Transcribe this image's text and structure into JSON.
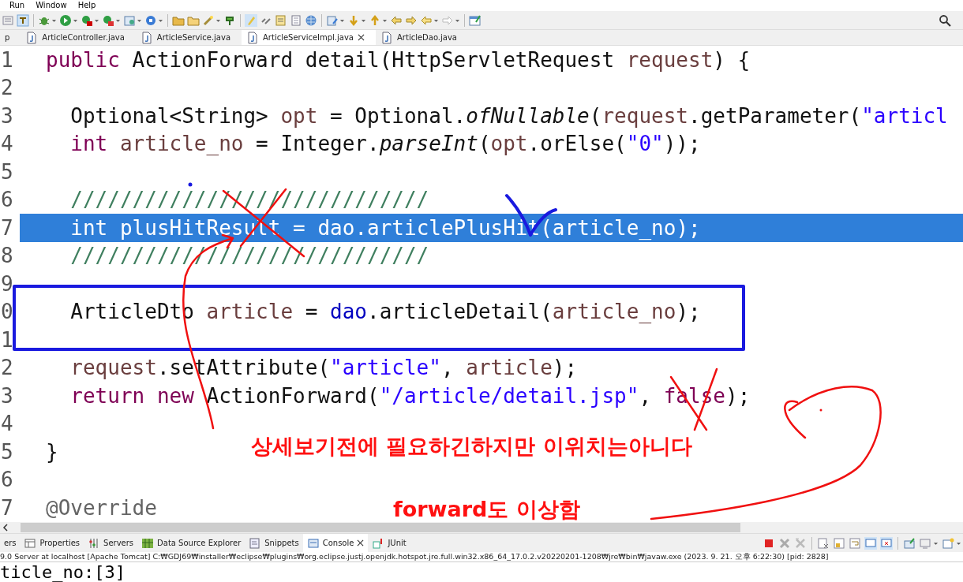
{
  "menu": [
    "Run",
    "Window",
    "Help"
  ],
  "editor_tabs": [
    {
      "label": "p",
      "selected": false,
      "java": false
    },
    {
      "label": "ArticleController.java",
      "selected": false,
      "java": true
    },
    {
      "label": "ArticleService.java",
      "selected": false,
      "java": true
    },
    {
      "label": "ArticleServiceImpl.java",
      "selected": true,
      "java": true
    },
    {
      "label": "ArticleDao.java",
      "selected": false,
      "java": true
    }
  ],
  "editor": {
    "lines": [
      {
        "number": "1",
        "selected": false,
        "tokens": [
          {
            "kind": "keyword",
            "text": "public"
          },
          {
            "kind": "plain",
            "text": " ActionForward detail(HttpServletRequest "
          },
          {
            "kind": "variable",
            "text": "request"
          },
          {
            "kind": "plain",
            "text": ") {"
          }
        ]
      },
      {
        "number": "2",
        "selected": false
      },
      {
        "number": "3",
        "selected": false,
        "tokens": [
          {
            "kind": "plain",
            "text": "  Optional<String> "
          },
          {
            "kind": "variable",
            "text": "opt"
          },
          {
            "kind": "plain",
            "text": " = Optional."
          },
          {
            "kind": "static",
            "text": "ofNullable"
          },
          {
            "kind": "plain",
            "text": "("
          },
          {
            "kind": "variable",
            "text": "request"
          },
          {
            "kind": "plain",
            "text": ".getParameter("
          },
          {
            "kind": "string",
            "text": "\"articl"
          }
        ]
      },
      {
        "number": "4",
        "selected": false,
        "tokens": [
          {
            "kind": "keyword",
            "text": "  int"
          },
          {
            "kind": "variable",
            "text": " article_no"
          },
          {
            "kind": "plain",
            "text": " = Integer."
          },
          {
            "kind": "static",
            "text": "parseInt"
          },
          {
            "kind": "plain",
            "text": "("
          },
          {
            "kind": "variable",
            "text": "opt"
          },
          {
            "kind": "plain",
            "text": ".orElse("
          },
          {
            "kind": "string",
            "text": "\"0\""
          },
          {
            "kind": "plain",
            "text": "));"
          }
        ]
      },
      {
        "number": "5",
        "selected": false
      },
      {
        "number": "6",
        "selected": false,
        "tokens": [
          {
            "kind": "comment",
            "text": "  /////////////////////////////"
          }
        ]
      },
      {
        "number": "7",
        "selected": true,
        "tokens": [
          {
            "kind": "keyword",
            "text": "  int"
          },
          {
            "kind": "variable",
            "text": " plusHitResult"
          },
          {
            "kind": "plain",
            "text": " = "
          },
          {
            "kind": "field",
            "text": "dao"
          },
          {
            "kind": "plain",
            "text": ".articlePlusHit("
          },
          {
            "kind": "variable",
            "text": "article_no"
          },
          {
            "kind": "plain",
            "text": ");"
          }
        ]
      },
      {
        "number": "8",
        "selected": false,
        "tokens": [
          {
            "kind": "comment",
            "text": "  /////////////////////////////"
          }
        ]
      },
      {
        "number": "9",
        "selected": false
      },
      {
        "number": "0",
        "selected": false,
        "tokens": [
          {
            "kind": "plain",
            "text": "  ArticleDto "
          },
          {
            "kind": "variable",
            "text": "article"
          },
          {
            "kind": "plain",
            "text": " = "
          },
          {
            "kind": "field",
            "text": "dao"
          },
          {
            "kind": "plain",
            "text": ".articleDetail("
          },
          {
            "kind": "variable",
            "text": "article_no"
          },
          {
            "kind": "plain",
            "text": ");"
          }
        ]
      },
      {
        "number": "1",
        "selected": false
      },
      {
        "number": "2",
        "selected": false,
        "tokens": [
          {
            "kind": "variable",
            "text": "  request"
          },
          {
            "kind": "plain",
            "text": ".setAttribute("
          },
          {
            "kind": "string",
            "text": "\"article\""
          },
          {
            "kind": "plain",
            "text": ", "
          },
          {
            "kind": "variable",
            "text": "article"
          },
          {
            "kind": "plain",
            "text": ");"
          }
        ]
      },
      {
        "number": "3",
        "selected": false,
        "tokens": [
          {
            "kind": "keyword",
            "text": "  return new"
          },
          {
            "kind": "plain",
            "text": " ActionForward("
          },
          {
            "kind": "string",
            "text": "\"/article/detail.jsp\""
          },
          {
            "kind": "plain",
            "text": ", "
          },
          {
            "kind": "keyword",
            "text": "false"
          },
          {
            "kind": "plain",
            "text": ");"
          }
        ]
      },
      {
        "number": "4",
        "selected": false
      },
      {
        "number": "5",
        "selected": false,
        "tokens": [
          {
            "kind": "plain",
            "text": "}"
          }
        ]
      },
      {
        "number": "6",
        "selected": false
      },
      {
        "number": "7",
        "selected": false,
        "tokens": [
          {
            "kind": "annotation",
            "text": "@Override"
          }
        ]
      }
    ]
  },
  "annotations": [
    {
      "text": "상세보기전에 필요하긴하지만 이위치는아니다"
    },
    {
      "text": "forward도 이상함"
    }
  ],
  "view_tabs": [
    {
      "label": "ers",
      "selected": false
    },
    {
      "label": "Properties",
      "selected": false
    },
    {
      "label": "Servers",
      "selected": false
    },
    {
      "label": "Data Source Explorer",
      "selected": false
    },
    {
      "label": "Snippets",
      "selected": false
    },
    {
      "label": "Console",
      "selected": true
    },
    {
      "label": "JUnit",
      "selected": false
    }
  ],
  "console": {
    "status": "9.0 Server at localhost [Apache Tomcat] C:₩GDJ69₩installer₩eclipse₩plugins₩org.eclipse.justj.openjdk.hotspot.jre.full.win32.x86_64_17.0.2.v20220201-1208₩jre₩bin₩javaw.exe  (2023. 9. 21. 오후 6:22:30) [pid: 2828]",
    "output": "ticle_no:[3]"
  }
}
